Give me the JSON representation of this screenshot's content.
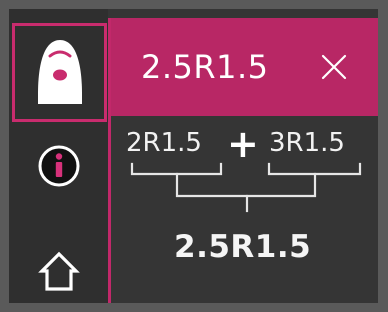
{
  "sidebar": {
    "items": [
      {
        "icon": "tool-icon",
        "active": true
      },
      {
        "icon": "info-icon",
        "active": false
      },
      {
        "icon": "home-icon",
        "active": false
      }
    ]
  },
  "header": {
    "title": "2.5R1.5",
    "close_icon": "close-icon"
  },
  "formula": {
    "term1": "2R1.5",
    "operator": "+",
    "term2": "3R1.5",
    "result": "2.5R1.5"
  },
  "colors": {
    "accent": "#c92c6e",
    "header_bg": "#b82765",
    "panel_bg": "#353535",
    "frame": "#5a5a5a"
  }
}
